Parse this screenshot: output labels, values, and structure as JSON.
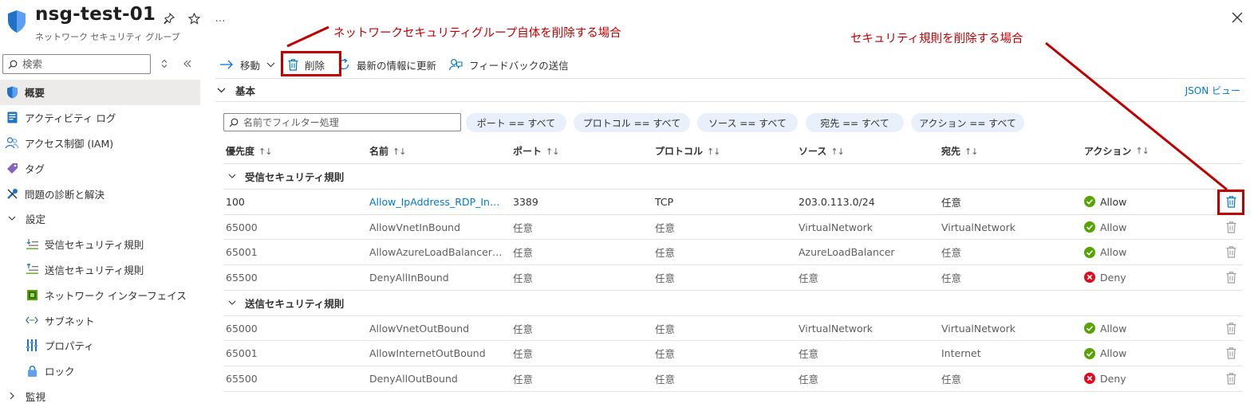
{
  "header": {
    "title": "nsg-test-01",
    "subtitle": "ネットワーク セキュリティ グループ",
    "more_label": "…"
  },
  "sidebar": {
    "search_placeholder": "検索",
    "items": [
      {
        "label": "概要",
        "icon": "shield-icon",
        "active": true
      },
      {
        "label": "アクティビティ ログ",
        "icon": "activity-log-icon"
      },
      {
        "label": "アクセス制御 (IAM)",
        "icon": "iam-icon"
      },
      {
        "label": "タグ",
        "icon": "tag-icon"
      },
      {
        "label": "問題の診断と解決",
        "icon": "wrench-icon"
      },
      {
        "label": "設定",
        "icon": "chevron-down-icon",
        "group": true
      },
      {
        "label": "受信セキュリティ規則",
        "icon": "inbound-rules-icon"
      },
      {
        "label": "送信セキュリティ規則",
        "icon": "outbound-rules-icon"
      },
      {
        "label": "ネットワーク インターフェイス",
        "icon": "network-interface-icon"
      },
      {
        "label": "サブネット",
        "icon": "subnet-icon"
      },
      {
        "label": "プロパティ",
        "icon": "properties-icon"
      },
      {
        "label": "ロック",
        "icon": "lock-icon"
      },
      {
        "label": "監視",
        "icon": "chevron-right-icon",
        "group": true
      }
    ]
  },
  "toolbar": {
    "move_label": "移動",
    "delete_label": "削除",
    "refresh_label": "最新の情報に更新",
    "feedback_label": "フィードバックの送信"
  },
  "essentials": {
    "label": "基本",
    "json_view": "JSON ビュー"
  },
  "filters": {
    "placeholder": "名前でフィルター処理",
    "pills": [
      "ポート == すべて",
      "プロトコル == すべて",
      "ソース == すべて",
      "宛先 == すべて",
      "アクション == すべて"
    ]
  },
  "table": {
    "columns": [
      "優先度",
      "名前",
      "ポート",
      "プロトコル",
      "ソース",
      "宛先",
      "アクション"
    ],
    "groups": [
      {
        "label": "受信セキュリティ規則",
        "rows": [
          {
            "priority": "100",
            "name": "Allow_IpAddress_RDP_Inbound",
            "port": "3389",
            "protocol": "TCP",
            "source": "203.0.113.0/24",
            "destination": "任意",
            "action": "Allow"
          },
          {
            "priority": "65000",
            "name": "AllowVnetInBound",
            "port": "任意",
            "protocol": "任意",
            "source": "VirtualNetwork",
            "destination": "VirtualNetwork",
            "action": "Allow"
          },
          {
            "priority": "65001",
            "name": "AllowAzureLoadBalancerInBound",
            "port": "任意",
            "protocol": "任意",
            "source": "AzureLoadBalancer",
            "destination": "任意",
            "action": "Allow"
          },
          {
            "priority": "65500",
            "name": "DenyAllInBound",
            "port": "任意",
            "protocol": "任意",
            "source": "任意",
            "destination": "任意",
            "action": "Deny"
          }
        ]
      },
      {
        "label": "送信セキュリティ規則",
        "rows": [
          {
            "priority": "65000",
            "name": "AllowVnetOutBound",
            "port": "任意",
            "protocol": "任意",
            "source": "VirtualNetwork",
            "destination": "VirtualNetwork",
            "action": "Allow"
          },
          {
            "priority": "65001",
            "name": "AllowInternetOutBound",
            "port": "任意",
            "protocol": "任意",
            "source": "任意",
            "destination": "Internet",
            "action": "Allow"
          },
          {
            "priority": "65500",
            "name": "DenyAllOutBound",
            "port": "任意",
            "protocol": "任意",
            "source": "任意",
            "destination": "任意",
            "action": "Deny"
          }
        ]
      }
    ]
  },
  "annotations": {
    "delete_nsg": "ネットワークセキュリティグループ自体を削除する場合",
    "delete_rule": "セキュリティ規則を削除する場合",
    "color": "#c00000"
  },
  "colors": {
    "accent": "#0078d4",
    "allow": "#57a300",
    "deny": "#e00b1c",
    "pill_bg": "#e8f1fb"
  }
}
